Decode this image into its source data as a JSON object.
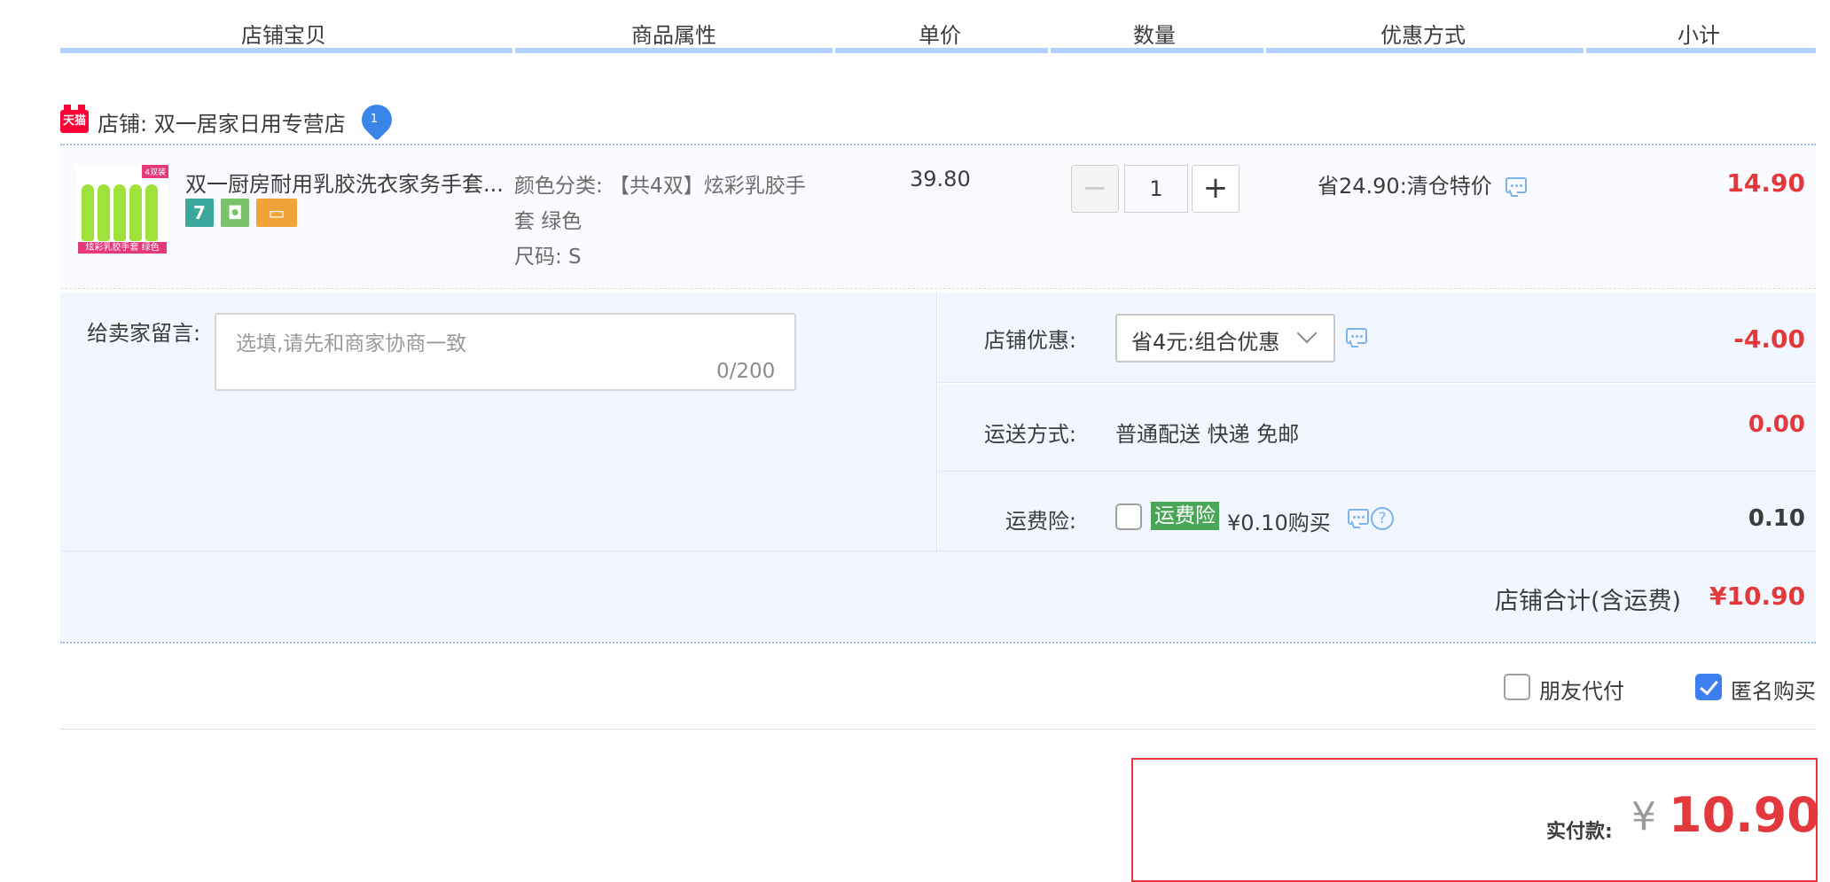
{
  "header": {
    "columns": [
      "店铺宝贝",
      "商品属性",
      "单价",
      "数量",
      "优惠方式",
      "小计"
    ]
  },
  "shop": {
    "badge": "天猫",
    "name": "店铺: 双一居家日用专营店"
  },
  "item": {
    "title": "双一厨房耐用乳胶洗衣家务手套...",
    "thumb_label": "炫彩乳胶手套 绿色",
    "thumb_tag": "4双装",
    "service_icons": [
      {
        "name": "seven-day-return-icon",
        "glyph": "7",
        "color": "#3aa89b"
      },
      {
        "name": "shield-icon",
        "glyph": "◘",
        "color": "#79c46a"
      },
      {
        "name": "card-icon",
        "glyph": "▭",
        "color": "#f1a33a"
      }
    ],
    "attributes": {
      "color_line1": "颜色分类: 【共4双】炫彩乳胶手",
      "color_line2": "套 绿色",
      "size": "尺码: S"
    },
    "unit_price": "39.80",
    "quantity": "1",
    "promo": "省24.90:清仓特价",
    "subtotal": "14.90"
  },
  "message": {
    "label": "给卖家留言:",
    "placeholder": "选填,请先和商家协商一致",
    "count": "0/200"
  },
  "shop_discount": {
    "label": "店铺优惠:",
    "selected": "省4元:组合优惠",
    "amount": "-4.00"
  },
  "shipping": {
    "label": "运送方式:",
    "method": "普通配送 快递 免邮",
    "amount": "0.00"
  },
  "shipping_insurance": {
    "label": "运费险:",
    "tag": "运费险",
    "price": "¥0.10购买",
    "checked": false,
    "amount": "0.10"
  },
  "shop_total": {
    "label": "店铺合计(含运费)",
    "value": "¥10.90"
  },
  "options": {
    "friend_pay": {
      "label": "朋友代付",
      "checked": false
    },
    "anonymous": {
      "label": "匿名购买",
      "checked": true
    }
  },
  "payment": {
    "label": "实付款:",
    "currency": "¥",
    "value": "10.90"
  },
  "colors": {
    "accent_red": "#e4393c",
    "header_bar": "#b2d1ff",
    "panel_bg": "#f2f7ff",
    "checkbox_on": "#3d7ff0",
    "insurance_tag": "#4aa657"
  }
}
